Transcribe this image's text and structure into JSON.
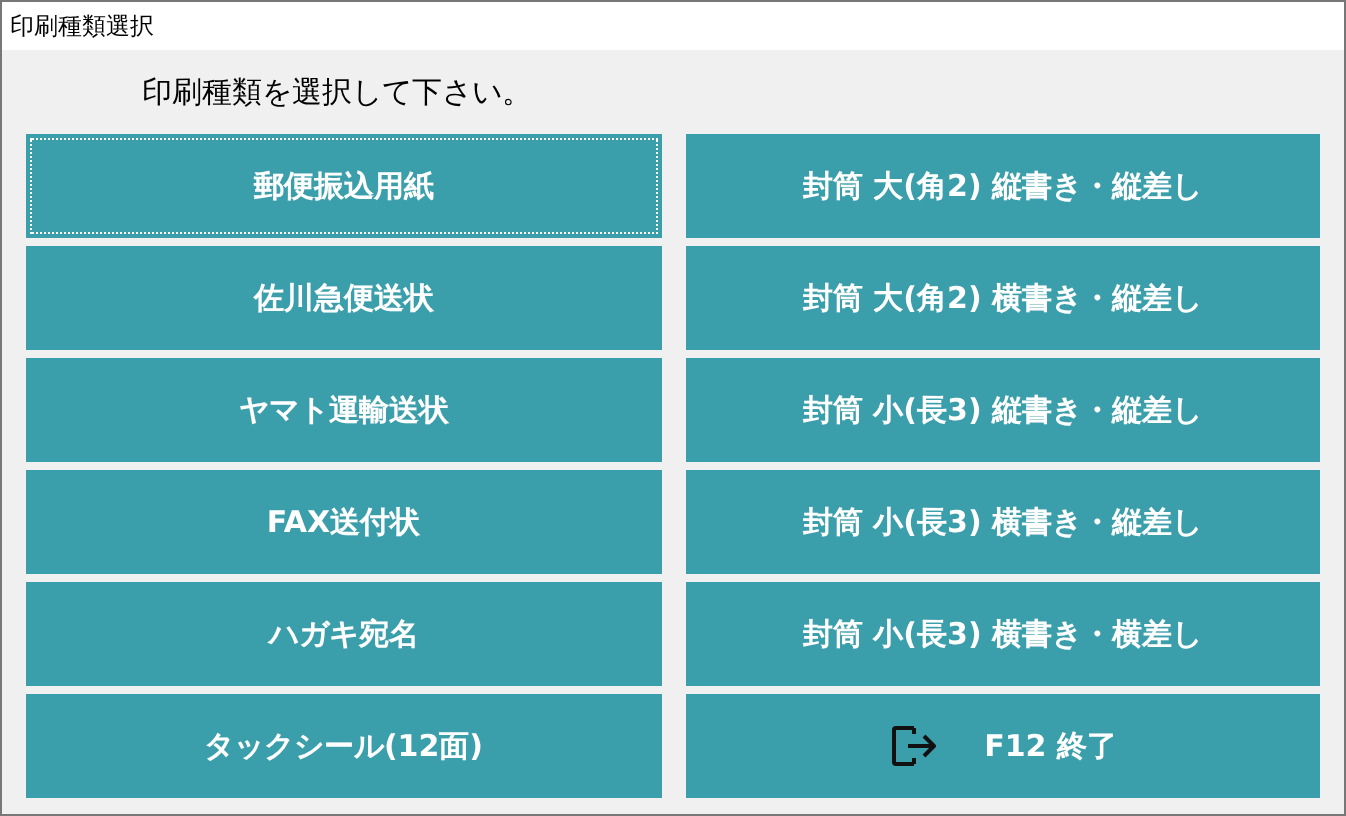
{
  "window": {
    "title": "印刷種類選択"
  },
  "prompt": "印刷種類を選択して下さい。",
  "buttons": [
    {
      "label": "郵便振込用紙",
      "focused": true
    },
    {
      "label": "封筒 大(角2) 縦書き・縦差し",
      "focused": false
    },
    {
      "label": "佐川急便送状",
      "focused": false
    },
    {
      "label": "封筒 大(角2) 横書き・縦差し",
      "focused": false
    },
    {
      "label": "ヤマト運輸送状",
      "focused": false
    },
    {
      "label": "封筒 小(長3) 縦書き・縦差し",
      "focused": false
    },
    {
      "label": "FAX送付状",
      "focused": false
    },
    {
      "label": "封筒 小(長3) 横書き・縦差し",
      "focused": false
    },
    {
      "label": "ハガキ宛名",
      "focused": false
    },
    {
      "label": "封筒 小(長3) 横書き・横差し",
      "focused": false
    },
    {
      "label": "タックシール(12面)",
      "focused": false
    },
    {
      "label": "F12 終了",
      "focused": false,
      "kind": "exit"
    }
  ]
}
